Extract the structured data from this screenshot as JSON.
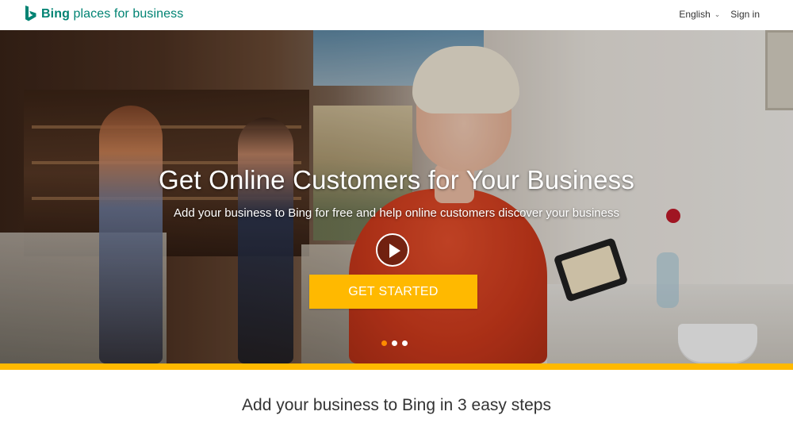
{
  "header": {
    "brand_bold": "Bing",
    "brand_rest": " places for business",
    "language": "English",
    "sign_in": "Sign in"
  },
  "hero": {
    "title": "Get Online Customers for Your Business",
    "subtitle": "Add your business to Bing for free and help online customers discover your business",
    "cta": "GET STARTED",
    "carousel_active_index": 0,
    "carousel_count": 3
  },
  "colors": {
    "brand_teal": "#008373",
    "accent_yellow": "#ffb900",
    "active_dot": "#ff8c00"
  },
  "icons": {
    "logo": "bing-logo-icon",
    "language": "chevron-down-icon",
    "video": "play-icon"
  },
  "steps": {
    "title": "Add your business to Bing in 3 easy steps"
  }
}
